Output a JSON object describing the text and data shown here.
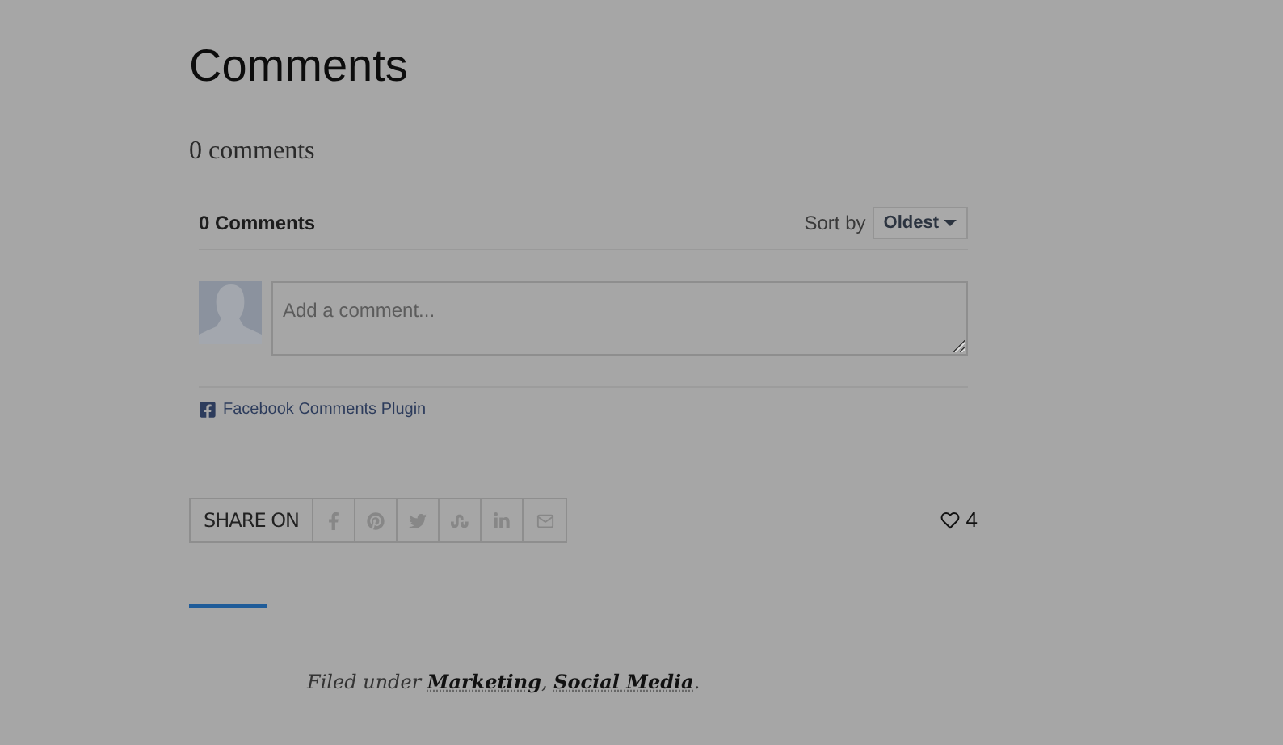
{
  "heading": "Comments",
  "comment_count": "0 comments",
  "plugin": {
    "title": "0 Comments",
    "sort_label": "Sort by",
    "sort_value": "Oldest",
    "placeholder": "Add a comment...",
    "footer": "Facebook Comments Plugin"
  },
  "share": {
    "label": "SHARE ON",
    "buttons": [
      {
        "kind": "facebook"
      },
      {
        "kind": "pinterest"
      },
      {
        "kind": "twitter"
      },
      {
        "kind": "stumbleupon"
      },
      {
        "kind": "linkedin"
      },
      {
        "kind": "email"
      }
    ]
  },
  "likes": "4",
  "filed": {
    "prefix": "Filed under",
    "links": [
      "Marketing",
      "Social Media"
    ],
    "separator": ",",
    "suffix": "."
  }
}
